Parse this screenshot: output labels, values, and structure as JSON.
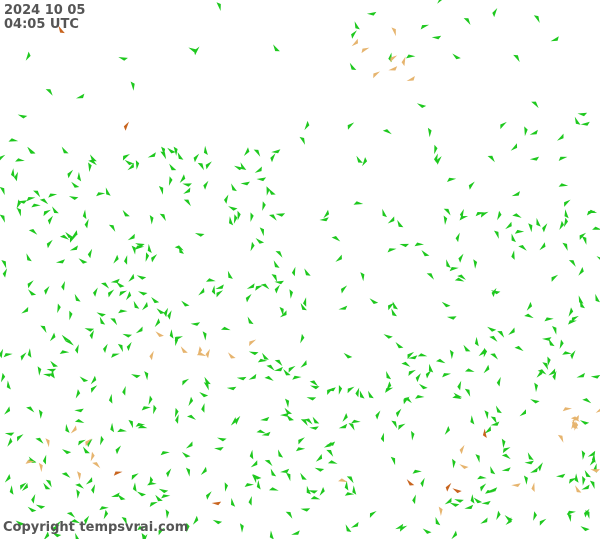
{
  "stamp": {
    "date": "2024 10 05",
    "time": "04:05 UTC"
  },
  "footer": {
    "copyright": "Copyright tempsvrai.com"
  },
  "legend_colors": {
    "calm": "#1ec81e",
    "moderate": "#e6b46e",
    "strong": "#c8641e"
  },
  "marker_counts": {
    "calm": 620,
    "moderate": 40,
    "strong": 8
  }
}
